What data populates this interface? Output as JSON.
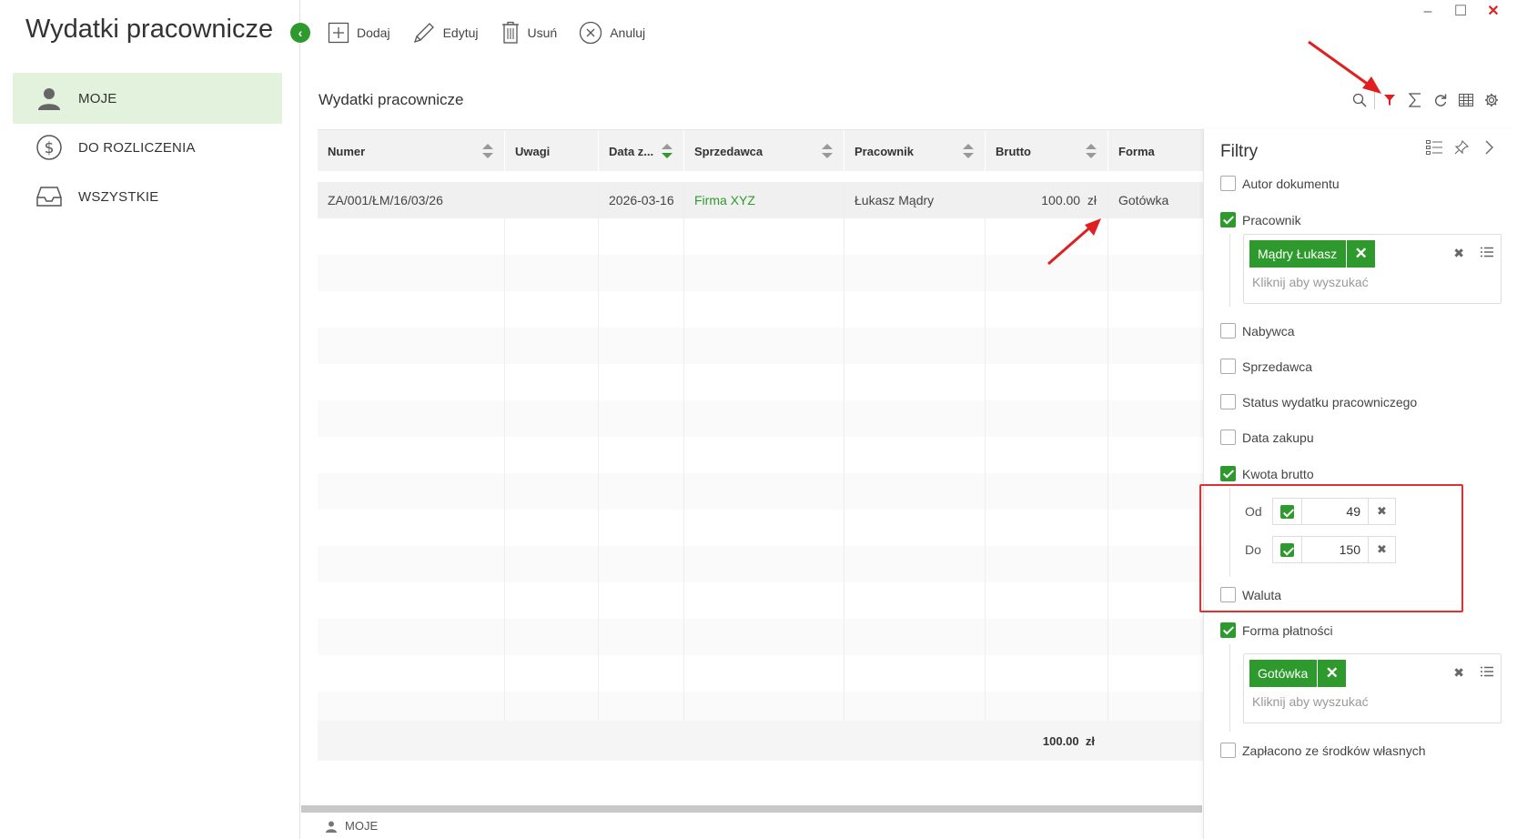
{
  "app": {
    "title": "Wydatki pracownicze",
    "window_controls": {
      "minimize": "–",
      "maximize": "☐",
      "close": "✕"
    }
  },
  "sidebar": {
    "items": [
      {
        "label": "MOJE",
        "icon": "user-icon",
        "active": true
      },
      {
        "label": "DO ROZLICZENIA",
        "icon": "dollar-circle-icon",
        "active": false
      },
      {
        "label": "WSZYSTKIE",
        "icon": "inbox-tray-icon",
        "active": false
      }
    ]
  },
  "toolbar": {
    "add_label": "Dodaj",
    "edit_label": "Edytuj",
    "delete_label": "Usuń",
    "cancel_label": "Anuluj"
  },
  "main": {
    "title": "Wydatki pracownicze",
    "header_icons": [
      "search-icon",
      "filter-icon",
      "sigma-icon",
      "refresh-icon",
      "grid-columns-icon",
      "settings-icon"
    ]
  },
  "grid": {
    "columns": [
      {
        "label": "Numer",
        "sortable": true,
        "active": false
      },
      {
        "label": "Uwagi",
        "sortable": false,
        "active": false
      },
      {
        "label": "Data z...",
        "sortable": true,
        "active": true
      },
      {
        "label": "Sprzedawca",
        "sortable": true,
        "active": false
      },
      {
        "label": "Pracownik",
        "sortable": true,
        "active": false
      },
      {
        "label": "Brutto",
        "sortable": true,
        "active": false
      },
      {
        "label": "Forma",
        "sortable": false,
        "active": false
      }
    ],
    "rows": [
      {
        "numer": "ZA/001/ŁM/16/03/26",
        "uwagi": "",
        "data": "2026-03-16",
        "sprzedawca": "Firma XYZ",
        "pracownik": "Łukasz Mądry",
        "brutto": "100.00",
        "currency": "zł",
        "forma": "Gotówka"
      }
    ],
    "footer_sum": "100.00",
    "footer_currency": "zł"
  },
  "filters": {
    "title": "Filtry",
    "items": {
      "autor": {
        "label": "Autor dokumentu",
        "checked": false
      },
      "pracownik": {
        "label": "Pracownik",
        "checked": true,
        "tag": "Mądry Łukasz",
        "placeholder": "Kliknij aby wyszukać"
      },
      "nabywca": {
        "label": "Nabywca",
        "checked": false
      },
      "sprzedawca": {
        "label": "Sprzedawca",
        "checked": false
      },
      "status": {
        "label": "Status wydatku pracowniczego",
        "checked": false
      },
      "data_zakupu": {
        "label": "Data zakupu",
        "checked": false
      },
      "kwota": {
        "label": "Kwota brutto",
        "checked": true,
        "from_label": "Od",
        "from_value": "49",
        "to_label": "Do",
        "to_value": "150"
      },
      "waluta": {
        "label": "Waluta",
        "checked": false
      },
      "forma": {
        "label": "Forma płatności",
        "checked": true,
        "tag": "Gotówka",
        "placeholder": "Kliknij aby wyszukać"
      },
      "zaplacono": {
        "label": "Zapłacono ze środków własnych",
        "checked": false
      }
    }
  },
  "status_bar": {
    "label": "MOJE"
  },
  "colors": {
    "accent": "#2e9a2e",
    "annotation": "#e03030",
    "active_nav": "#e3f2dc"
  }
}
